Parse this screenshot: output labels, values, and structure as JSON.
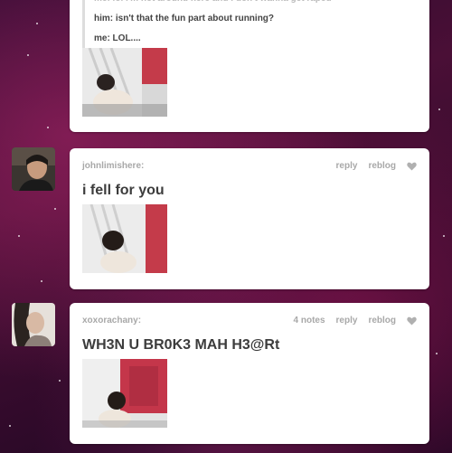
{
  "posts": [
    {
      "chat": [
        {
          "text": "me: lol i'm not around here and i don't wanna get raped"
        },
        {
          "text": "him: isn't that the fun part about running?"
        },
        {
          "text": "me: LOL...."
        }
      ]
    },
    {
      "username": "johnlimishere:",
      "notes": "",
      "reply_label": "reply",
      "reblog_label": "reblog",
      "text": "i fell for you"
    },
    {
      "username": "xoxorachany:",
      "notes": "4 notes",
      "reply_label": "reply",
      "reblog_label": "reblog",
      "text": "WH3N U BR0K3 MAH H3@Rt"
    }
  ],
  "colors": {
    "heart": "#b0b0b0",
    "meta_text": "#a8a8a8",
    "body_text": "#3c3c3c"
  },
  "icons": {
    "like": "heart-icon"
  }
}
